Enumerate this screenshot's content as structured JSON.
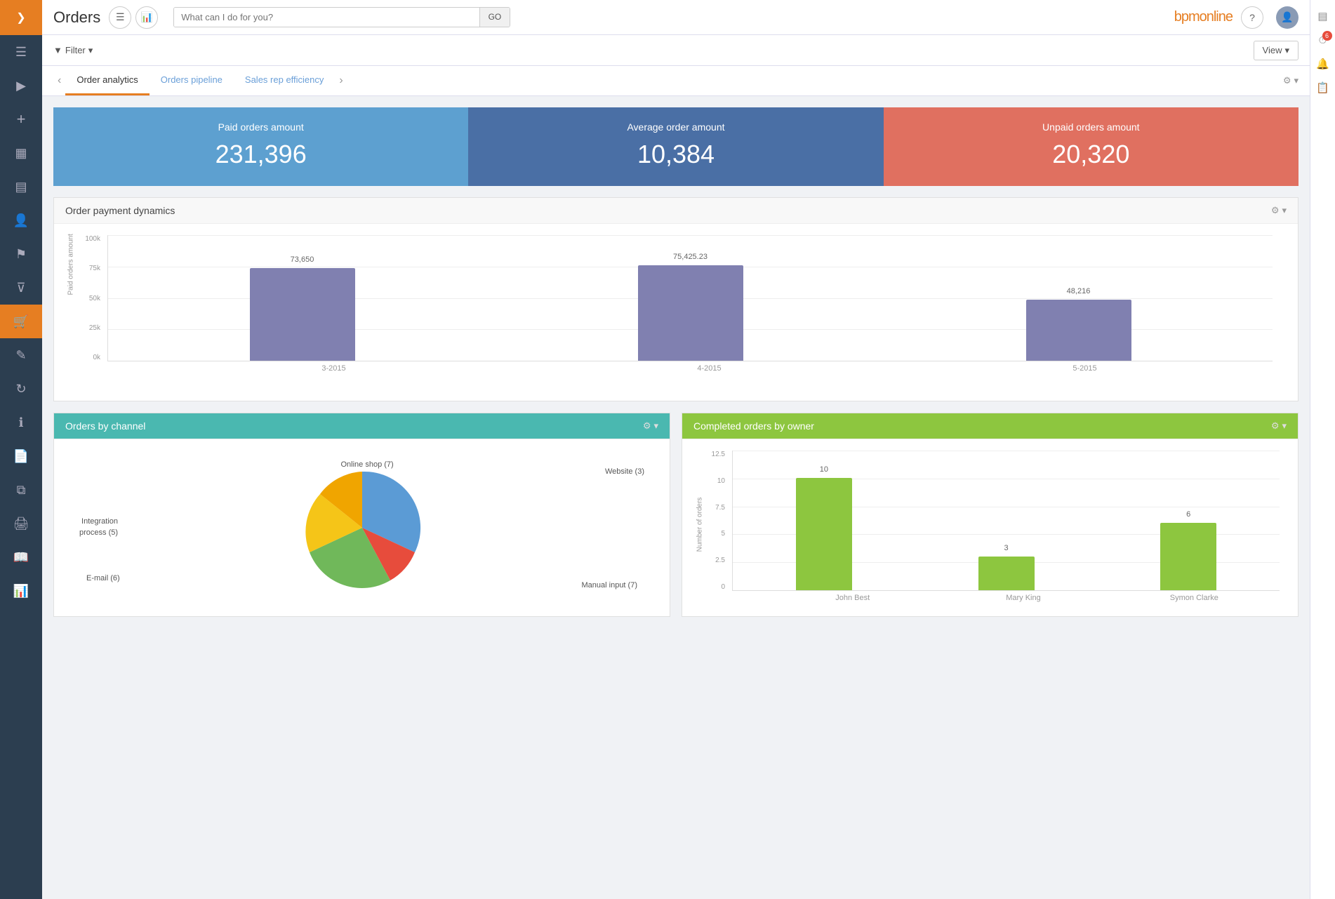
{
  "topbar": {
    "title": "Orders",
    "search_placeholder": "What can I do for you?",
    "search_go": "GO",
    "logo": "bpm",
    "logo_accent": "online"
  },
  "filter": {
    "label": "Filter",
    "view_label": "View"
  },
  "tabs": [
    {
      "id": "order-analytics",
      "label": "Order analytics",
      "active": true
    },
    {
      "id": "orders-pipeline",
      "label": "Orders pipeline",
      "active": false
    },
    {
      "id": "sales-rep",
      "label": "Sales rep efficiency",
      "active": false
    }
  ],
  "kpi": [
    {
      "id": "paid",
      "label": "Paid orders amount",
      "value": "231,396",
      "color": "blue"
    },
    {
      "id": "average",
      "label": "Average order amount",
      "value": "10,384",
      "color": "dark-blue"
    },
    {
      "id": "unpaid",
      "label": "Unpaid orders amount",
      "value": "20,320",
      "color": "orange"
    }
  ],
  "payment_dynamics": {
    "title": "Order payment dynamics",
    "y_axis_label": "Paid orders amount",
    "y_labels": [
      "100k",
      "75k",
      "50k",
      "25k",
      "0k"
    ],
    "bars": [
      {
        "label": "73,650",
        "x_label": "3-2015",
        "height_pct": 73.65
      },
      {
        "label": "75,425.23",
        "x_label": "4-2015",
        "height_pct": 75.43
      },
      {
        "label": "48,216",
        "x_label": "5-2015",
        "height_pct": 48.22
      }
    ]
  },
  "orders_by_channel": {
    "title": "Orders by channel",
    "segments": [
      {
        "label": "Online shop (7)",
        "color": "#5b9bd5",
        "pct": 20
      },
      {
        "label": "Website (3)",
        "color": "#e74c3c",
        "pct": 8
      },
      {
        "label": "Integration process (5)",
        "color": "#f0a500",
        "pct": 14
      },
      {
        "label": "E-mail (6)",
        "color": "#f5c518",
        "pct": 17
      },
      {
        "label": "Manual input (7)",
        "color": "#70b85a",
        "pct": 20
      }
    ]
  },
  "completed_orders": {
    "title": "Completed orders by owner",
    "y_labels": [
      "12.5",
      "10",
      "7.5",
      "5",
      "2.5",
      "0"
    ],
    "y_axis_label": "Number of orders",
    "bars": [
      {
        "label": "10",
        "x_label": "John Best",
        "height_pct": 80
      },
      {
        "label": "3",
        "x_label": "Mary King",
        "height_pct": 24
      },
      {
        "label": "6",
        "x_label": "Symon Clarke",
        "height_pct": 48
      }
    ]
  },
  "right_sidebar": {
    "badge_count": "6"
  },
  "sidebar_items": [
    {
      "id": "chevron",
      "icon": "❯"
    },
    {
      "id": "menu",
      "icon": "☰"
    },
    {
      "id": "play",
      "icon": "▶"
    },
    {
      "id": "plus",
      "icon": "+"
    },
    {
      "id": "chart",
      "icon": "▦"
    },
    {
      "id": "list",
      "icon": "▤"
    },
    {
      "id": "person",
      "icon": "👤"
    },
    {
      "id": "flag",
      "icon": "⚑"
    },
    {
      "id": "funnel",
      "icon": "⊽"
    },
    {
      "id": "cart",
      "icon": "🛒"
    },
    {
      "id": "edit",
      "icon": "✎"
    },
    {
      "id": "refresh",
      "icon": "↻"
    },
    {
      "id": "info",
      "icon": "ℹ"
    },
    {
      "id": "doc",
      "icon": "📄"
    },
    {
      "id": "copy",
      "icon": "⧉"
    },
    {
      "id": "print",
      "icon": "🖨"
    },
    {
      "id": "book",
      "icon": "📖"
    },
    {
      "id": "bar",
      "icon": "📊"
    }
  ]
}
